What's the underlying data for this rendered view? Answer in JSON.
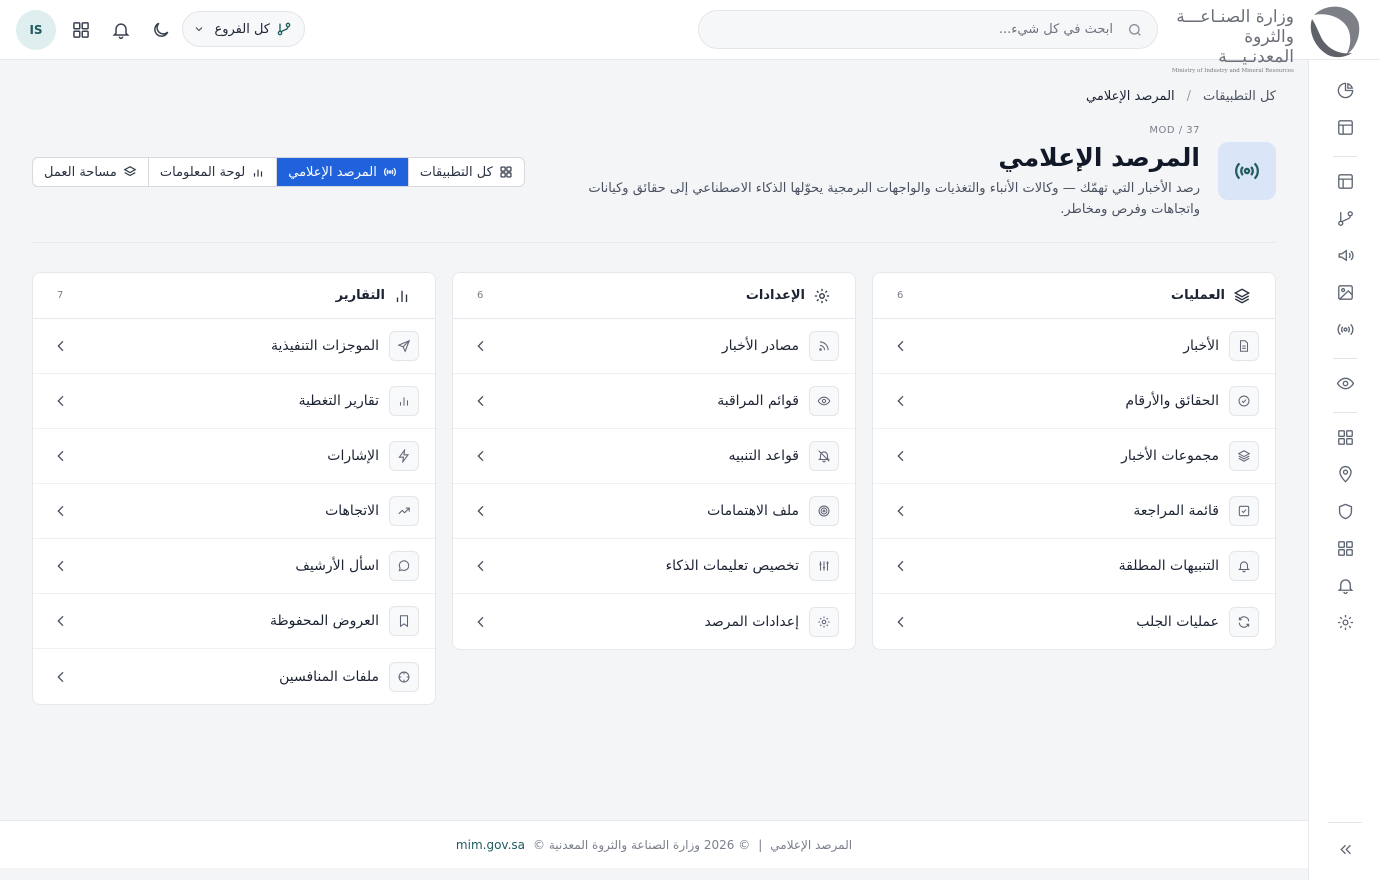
{
  "brand": {
    "line1": "وزارة الصنـاعـــة",
    "line2": "والثروة المعدنـيـــة",
    "line3": "Ministry of Industry and Mineral Resources"
  },
  "search": {
    "placeholder": "ابحث في كل شيء..."
  },
  "branch": {
    "label": "كل الفروع"
  },
  "user": {
    "initials": "IS"
  },
  "breadcrumb": {
    "root": "كل التطبيقات",
    "separator": "/",
    "current": "المرصد الإعلامي"
  },
  "header": {
    "mod": "MOD / 37",
    "title": "المرصد الإعلامي",
    "description": "رصد الأخبار التي تهمّك — وكالات الأنباء والتغذيات والواجهات البرمجية يحوّلها الذكاء الاصطناعي إلى حقائق وكيانات واتجاهات وفرص ومخاطر."
  },
  "tabs": [
    {
      "label": "كل التطبيقات",
      "icon": "grid-icon"
    },
    {
      "label": "المرصد الإعلامي",
      "icon": "broadcast-icon"
    },
    {
      "label": "لوحة المعلومات",
      "icon": "bar-chart-icon"
    },
    {
      "label": "مساحة العمل",
      "icon": "layers-icon"
    }
  ],
  "cards": {
    "operations": {
      "title": "العمليات",
      "count": "6",
      "items": [
        "الأخبار",
        "الحقائق والأرقام",
        "مجموعات الأخبار",
        "قائمة المراجعة",
        "التنبيهات المطلقة",
        "عمليات الجلب"
      ]
    },
    "settings": {
      "title": "الإعدادات",
      "count": "6",
      "items": [
        "مصادر الأخبار",
        "قوائم المراقبة",
        "قواعد التنبيه",
        "ملف الاهتمامات",
        "تخصيص تعليمات الذكاء",
        "إعدادات المرصد"
      ]
    },
    "reports": {
      "title": "التقارير",
      "count": "7",
      "items": [
        "الموجزات التنفيذية",
        "تقارير التغطية",
        "الإشارات",
        "الاتجاهات",
        "اسأل الأرشيف",
        "العروض المحفوظة",
        "ملفات المنافسين"
      ]
    }
  },
  "footer": {
    "app": "المرصد الإعلامي",
    "divider": "|",
    "copyright": "© 2026 وزارة الصناعة والثروة المعدنية ©",
    "link": "mim.gov.sa"
  },
  "colors": {
    "accent": "#1f62dc",
    "header_icon_bg": "#dbe5f8",
    "teal": "#1f5b5f"
  }
}
